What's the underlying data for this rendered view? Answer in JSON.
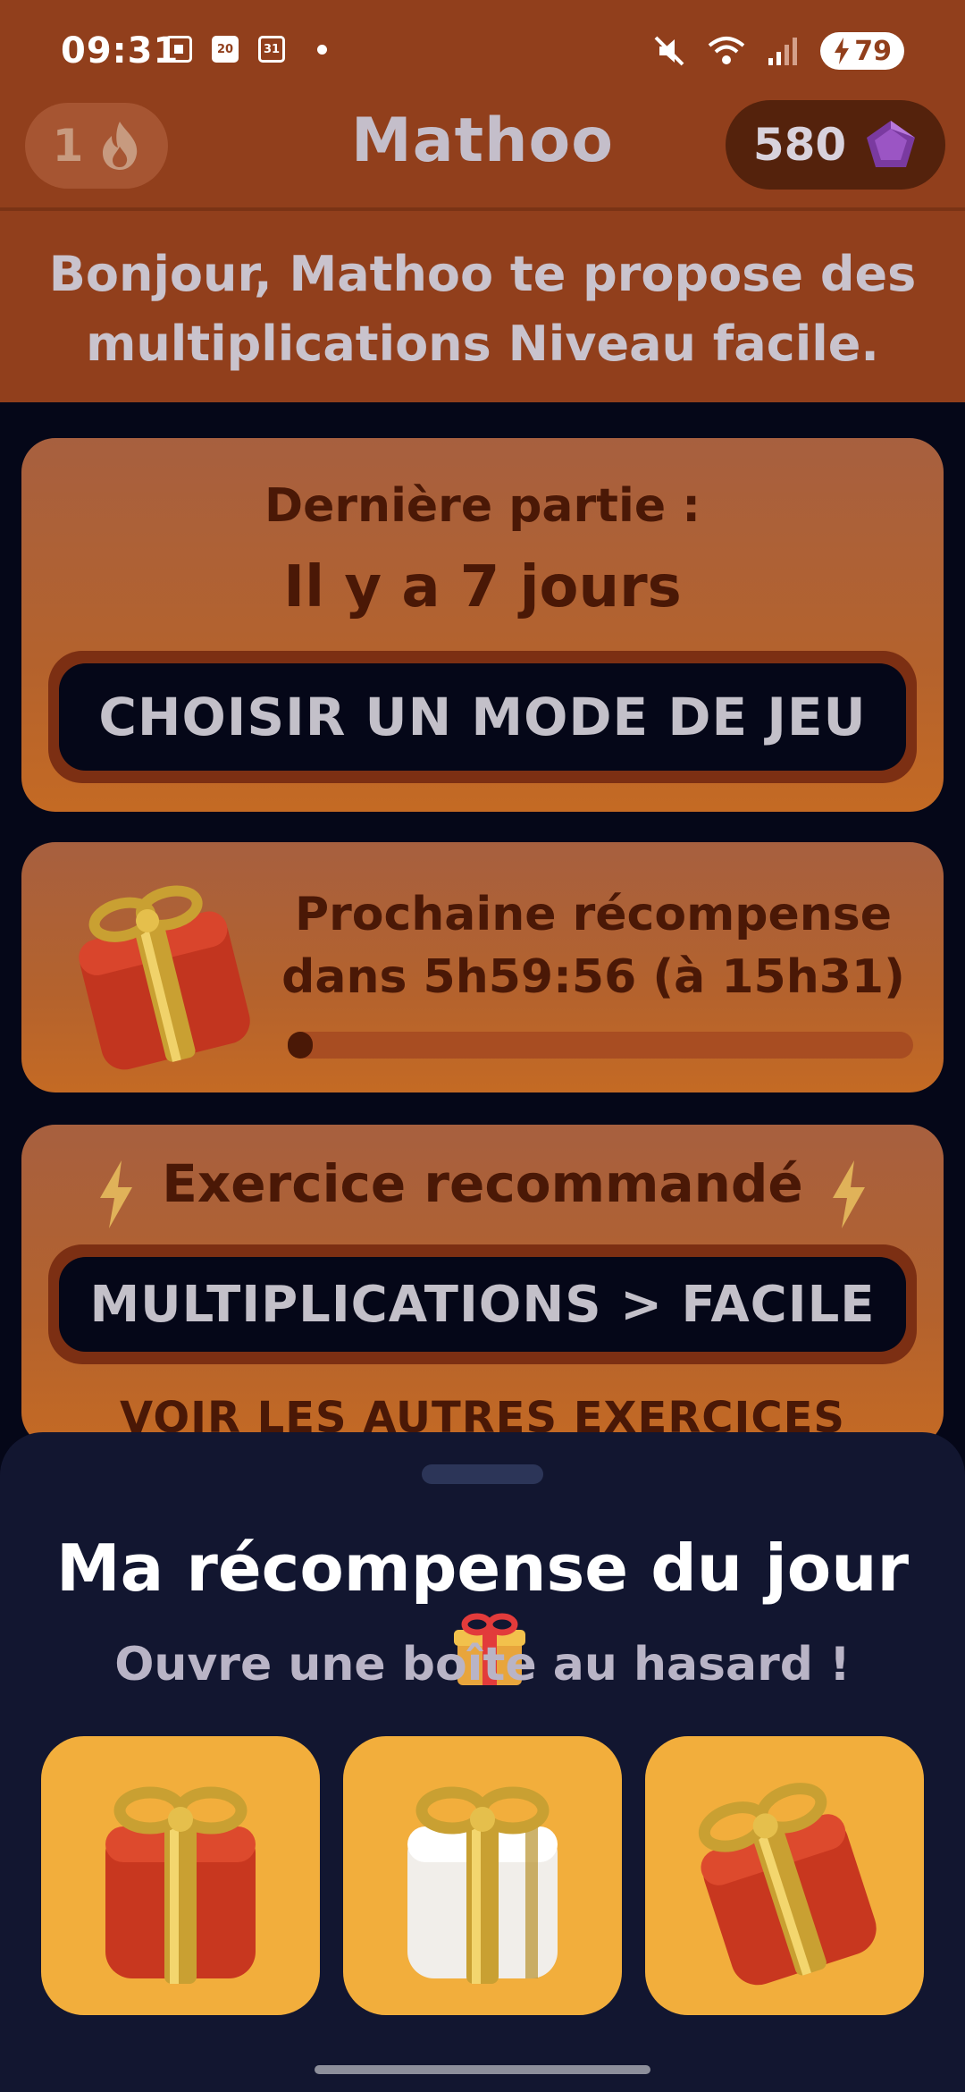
{
  "status_bar": {
    "time": "09:31",
    "calendar_day": "20",
    "calendar_icon_day": "31",
    "battery": "79",
    "icons_left": [
      "screenshot-icon",
      "calendar-icon",
      "calendar-outline-icon",
      "dot-icon"
    ],
    "icons_right": [
      "mute-icon",
      "wifi-icon",
      "signal-icon",
      "battery-icon"
    ]
  },
  "header": {
    "streak_count": "1",
    "app_title": "Mathoo",
    "gems_count": "580",
    "greeting": "Bonjour, Mathoo te propose des multiplications Niveau facile."
  },
  "last_game": {
    "label": "Dernière partie :",
    "value": "Il y a 7 jours",
    "button": "CHOISIR UN MODE DE JEU"
  },
  "next_reward": {
    "line1": "Prochaine récompense",
    "line2": "dans 5h59:56 (à 15h31)",
    "progress": 0.005
  },
  "recommended": {
    "title": "Exercice recommandé",
    "button": "MULTIPLICATIONS > FACILE",
    "other_link": "VOIR LES AUTRES EXERCICES"
  },
  "sheet": {
    "title": "Ma récompense du jour",
    "subtitle": "Ouvre une boîte au hasard !",
    "boxes": [
      "red-gift-box",
      "white-gift-box",
      "red-tilted-gift-box"
    ]
  },
  "colors": {
    "header_bg": "#913f1c",
    "card_text": "#4a1806",
    "page_bg": "#050718",
    "sheet_bg": "#121630",
    "box_tile": "#f2ae3c"
  }
}
